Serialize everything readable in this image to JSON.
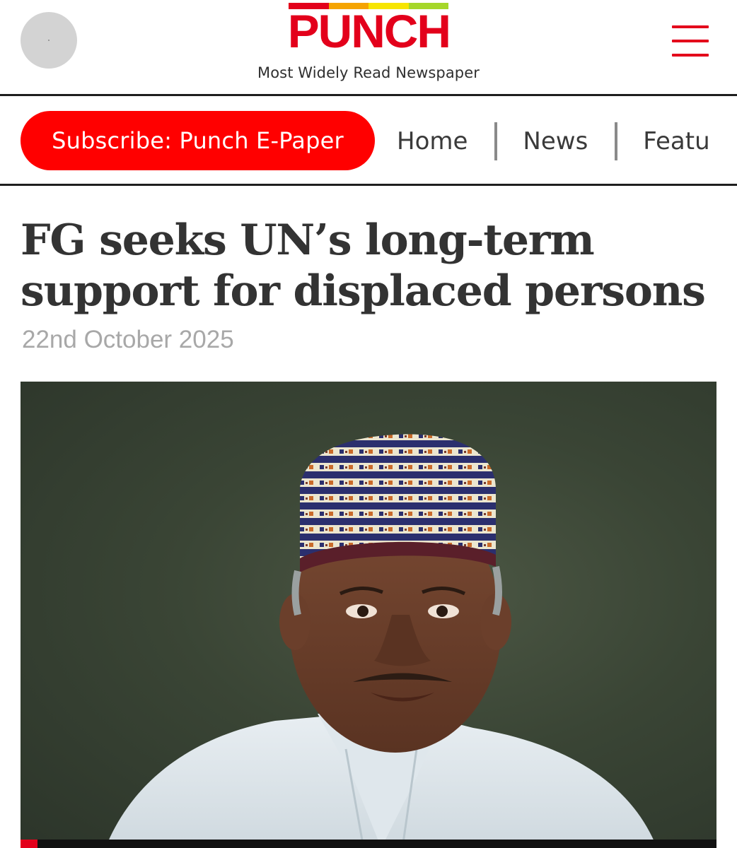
{
  "header": {
    "logo_text": "PUNCH",
    "logo_bar_colors": [
      "#e3001b",
      "#f5a400",
      "#f7e500",
      "#a6d72a"
    ],
    "tagline": "Most Widely Read Newspaper",
    "avatar_icon": "user-avatar",
    "menu_icon": "hamburger-menu-icon"
  },
  "nav": {
    "subscribe_label": "Subscribe: Punch E-Paper",
    "items": [
      "Home",
      "News",
      "Featu"
    ]
  },
  "article": {
    "headline_line1": "FG seeks UN’s long-term",
    "headline_line2": "support for displaced persons",
    "date": "22nd October 2025",
    "image_subject": "portrait-of-man-in-embroidered-cap-and-white-robe"
  },
  "colors": {
    "brand_red": "#e3001b",
    "subscribe_bg": "#ff0000",
    "date_gray": "#a8a8a8",
    "photo_bg": "#3a4535"
  }
}
